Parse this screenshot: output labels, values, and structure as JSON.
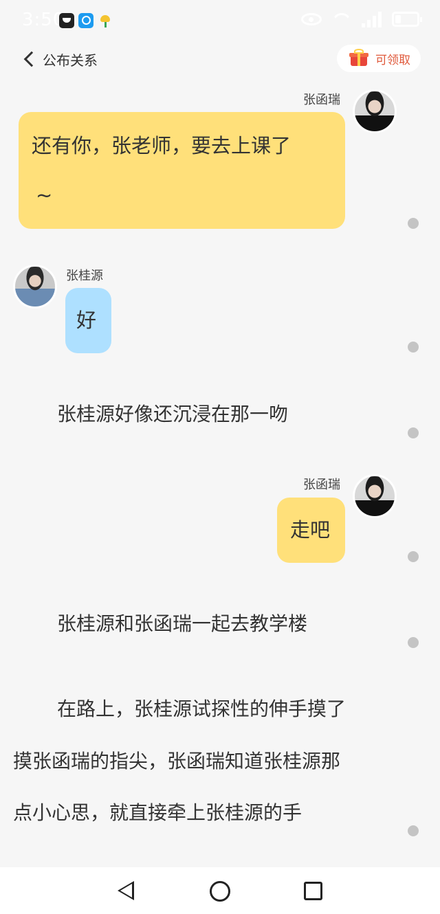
{
  "status_bar": {
    "time": "3:50",
    "icons": [
      "messaging-app-icon",
      "search-app-icon",
      "notification-app-icon",
      "eye-icon",
      "wifi-icon",
      "signal-icon",
      "battery-icon"
    ]
  },
  "header": {
    "back_label": "公布关系",
    "reward_label": "可领取"
  },
  "messages": [
    {
      "type": "chat",
      "side": "right",
      "sender": "张函瑞",
      "text_lines": [
        "还有你，张老师，要去上课了",
        "~"
      ],
      "bubble_color": "#ffe07a"
    },
    {
      "type": "chat",
      "side": "left",
      "sender": "张桂源",
      "text": "好",
      "bubble_color": "#aee0ff"
    },
    {
      "type": "narration",
      "text": "张桂源好像还沉浸在那一吻"
    },
    {
      "type": "chat",
      "side": "right",
      "sender": "张函瑞",
      "text": "走吧",
      "bubble_color": "#ffe07a"
    },
    {
      "type": "narration",
      "text": "张桂源和张函瑞一起去教学楼"
    },
    {
      "type": "narration",
      "text_lines": [
        "在路上，张桂源试探性的伸手摸了",
        "摸张函瑞的指尖，张函瑞知道张桂源那",
        "点小心思，就直接牵上张桂源的手"
      ]
    }
  ],
  "nav_bar": {
    "icons": [
      "back-triangle-icon",
      "home-circle-icon",
      "recent-square-icon"
    ]
  },
  "colors": {
    "background": "#f6f6f6",
    "yellow_bubble": "#ffe07a",
    "blue_bubble": "#aee0ff",
    "reward_text": "#e05a3c"
  }
}
